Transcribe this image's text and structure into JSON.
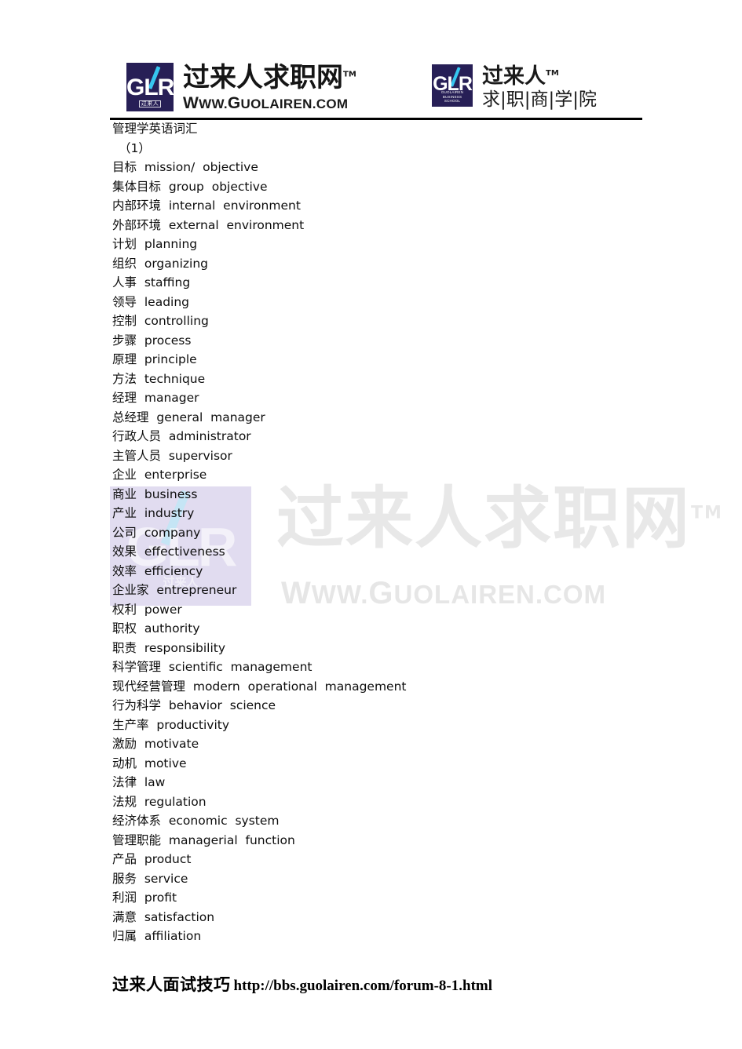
{
  "header": {
    "logo_primary": {
      "mark_letters": "GLR",
      "mark_sublabel": "过来人",
      "wordmark_cn": "过来人求职网",
      "wordmark_tm": "TM",
      "wordmark_url_lead": "W",
      "wordmark_url": "WW.",
      "wordmark_url_brand_lead": "G",
      "wordmark_url_brand": "UOLAIREN.COM",
      "icon_slash": "diagonal-slash"
    },
    "logo_secondary": {
      "mark_letters": "GLR",
      "mark_sublabel_line1": "GUOLAIREN",
      "mark_sublabel_line2": "BUSINESS",
      "mark_sublabel_line3": "SCHOOL",
      "wordmark_cn": "过来人",
      "wordmark_tm": "TM",
      "wordmark_cn_sub": "求|职|商|学|院"
    }
  },
  "watermark": {
    "text_cn": "过来人求职网",
    "tm": "TM",
    "url_lead": "W",
    "url_mid": "WW.",
    "url_brand_lead": "G",
    "url_brand": "UOLAIREN.COM",
    "box_letters": "GLR",
    "box_sublabel": "过来人",
    "tint_color": "#c9c0e4"
  },
  "document": {
    "title": "管理学英语词汇",
    "section": "（1）",
    "entries": [
      "目标  mission/  objective",
      "集体目标  group  objective",
      "内部环境  internal  environment",
      "外部环境  external  environment",
      "计划  planning",
      "组织  organizing",
      "人事  staffing",
      "领导  leading",
      "控制  controlling",
      "步骤  process",
      "原理  principle",
      "方法  technique",
      "经理  manager",
      "总经理  general  manager",
      "行政人员  administrator",
      "主管人员  supervisor",
      "企业  enterprise",
      "商业  business",
      "产业  industry",
      "公司  company",
      "效果  effectiveness",
      "效率  efficiency",
      "企业家  entrepreneur",
      "权利  power",
      "职权  authority",
      "职责  responsibility",
      "科学管理  scientific  management",
      "现代经营管理  modern  operational  management",
      "行为科学  behavior  science",
      "生产率  productivity",
      "激励  motivate",
      "动机  motive",
      "法律  law",
      "法规  regulation",
      "经济体系  economic  system",
      "管理职能  managerial  function",
      "产品  product",
      "服务  service",
      "利润  profit",
      "满意  satisfaction",
      "归属  affiliation"
    ]
  },
  "footer": {
    "label_cn": "过来人面试技巧",
    "url": "http://bbs.guolairen.com/forum-8-1.html"
  }
}
